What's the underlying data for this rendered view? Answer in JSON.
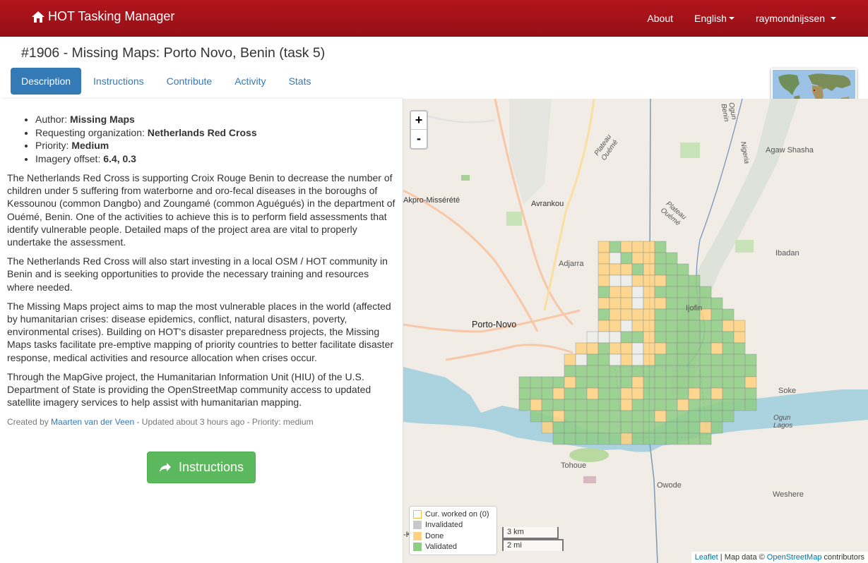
{
  "nav": {
    "brand": "HOT Tasking Manager",
    "about": "About",
    "language": "English",
    "user": "raymondnijssen",
    "color": "#ac1219"
  },
  "title": "#1906 - Missing Maps: Porto Novo, Benin (task 5)",
  "tabs": [
    "Description",
    "Instructions",
    "Contribute",
    "Activity",
    "Stats"
  ],
  "meta": {
    "author_label": "Author:",
    "author": "Missing Maps",
    "org_label": "Requesting organization:",
    "org": "Netherlands Red Cross",
    "priority_label": "Priority:",
    "priority": "Medium",
    "imagery_label": "Imagery offset:",
    "imagery": "6.4, 0.3"
  },
  "description": [
    "The Netherlands Red Cross is supporting Croix Rouge Benin to decrease the number of children under 5 suffering from waterborne and oro-fecal diseases in the boroughs of Kessounou (common Dangbo) and Zoungamé (common Aguégués) in the department of Ouémé, Benin. One of the activities to achieve this is to perform field assessments that identify vulnerable people. Detailed maps of the project area are vital to properly undertake the assessment.",
    "The Netherlands Red Cross will also start investing in a local OSM / HOT community in Benin and is seeking opportunities to provide the necessary training and resources where needed.",
    "The Missing Maps project aims to map the most vulnerable places in the world (affected by humanitarian crises: disease epidemics, conflict, natural disasters, poverty, environmental crises). Building on HOT's disaster preparedness projects, the Missing Maps tasks facilitate pre-emptive mapping of priority countries to better facilitate disaster response, medical activities and resource allocation when crises occur.",
    "Through the MapGive project, the Humanitarian Information Unit (HIU) of the U.S. Department of State is providing the OpenStreetMap community access to updated satellite imagery services to help assist with humanitarian mapping."
  ],
  "created": {
    "prefix": "Created by",
    "author": "Maarten van der Veen",
    "suffix": "- Updated about 3 hours ago - Priority: medium"
  },
  "instructions_button": "Instructions",
  "map": {
    "zoom_in": "+",
    "zoom_out": "-",
    "places": {
      "porto_novo": "Porto-Novo",
      "avrankou": "Avrankou",
      "adjarra": "Adjarra",
      "akpro": "Akpro-Missérété",
      "agaw": "Agaw Shasha",
      "ibadan": "Ibadan",
      "ijofin": "Ijofin",
      "soke": "Soke",
      "tohoue": "Tohoue",
      "owode": "Owode",
      "weshere": "Weshere",
      "ogun_lagos": "Ogun Lagos",
      "plateau_oueme1": "Plateau Ouémé",
      "plateau_oueme2": "Plateau Ouémé",
      "ogun_benin": "Ogun Benin",
      "nigeria": "Nigeria",
      "left_edge": "-K"
    },
    "legend": [
      {
        "label": "Cur. worked on (0)",
        "color": "#ffffff",
        "border": "#f0c040"
      },
      {
        "label": "Invalidated",
        "color": "#c8c8c8",
        "border": "#c8c8c8"
      },
      {
        "label": "Done",
        "color": "#ffd27f",
        "border": "#ffd27f"
      },
      {
        "label": "Validated",
        "color": "#8fcc85",
        "border": "#8fcc85"
      }
    ],
    "scale_km": "3 km",
    "scale_mi": "2 mi",
    "attribution": {
      "leaflet": "Leaflet",
      "mid": "| Map data ©",
      "osm": "OpenStreetMap",
      "end": "contributors"
    }
  }
}
